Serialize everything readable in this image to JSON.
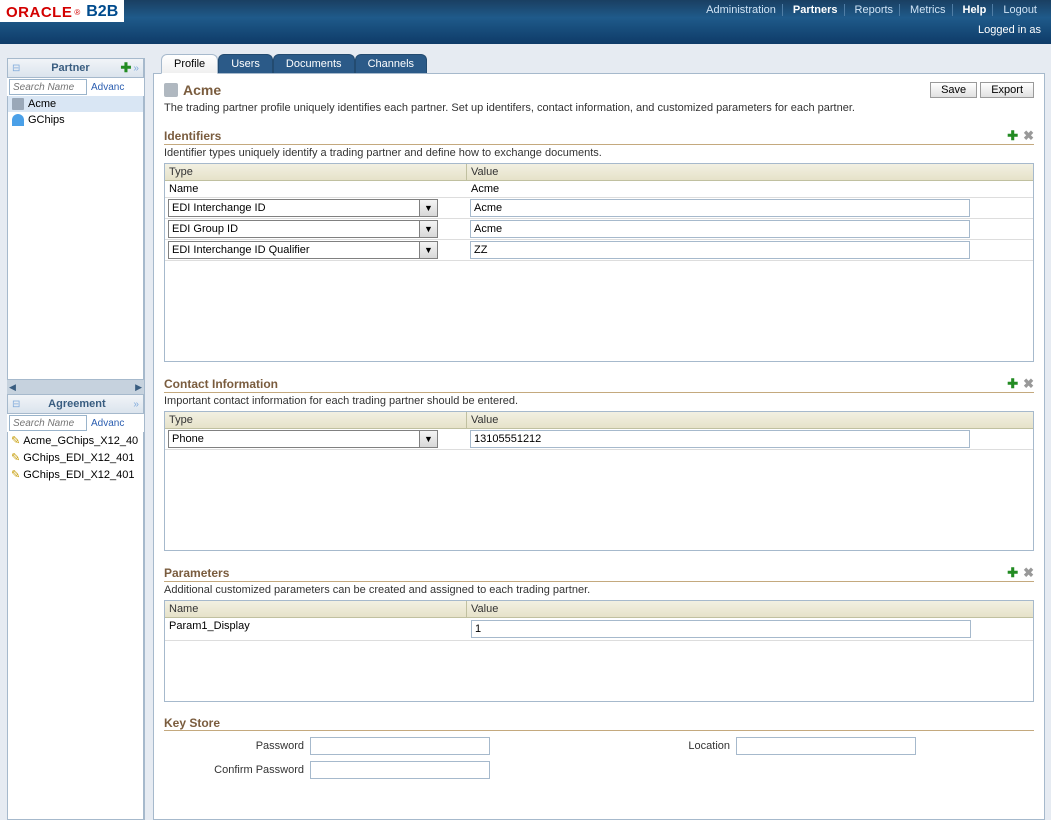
{
  "brand": {
    "oracle": "ORACLE",
    "b2b": "B2B"
  },
  "topnav": {
    "administration": "Administration",
    "partners": "Partners",
    "reports": "Reports",
    "metrics": "Metrics",
    "help": "Help",
    "logout": "Logout"
  },
  "logged_in_label": "Logged in as",
  "sidebar": {
    "partner_title": "Partner",
    "search_placeholder": "Search Name",
    "advanced": "Advanc",
    "items": [
      {
        "label": "Acme"
      },
      {
        "label": "GChips"
      }
    ],
    "agreement_title": "Agreement",
    "agreements": [
      {
        "label": "Acme_GChips_X12_40"
      },
      {
        "label": "GChips_EDI_X12_401"
      },
      {
        "label": "GChips_EDI_X12_401"
      }
    ]
  },
  "tabs": {
    "profile": "Profile",
    "users": "Users",
    "documents": "Documents",
    "channels": "Channels"
  },
  "page": {
    "title": "Acme",
    "desc": "The trading partner profile uniquely identifies each partner. Set up identifers, contact information, and customized parameters for each partner.",
    "save": "Save",
    "export": "Export"
  },
  "identifiers": {
    "title": "Identifiers",
    "desc": "Identifier types uniquely identify a trading partner and define how to exchange documents.",
    "col_type": "Type",
    "col_value": "Value",
    "static_type": "Name",
    "static_value": "Acme",
    "rows": [
      {
        "type": "EDI Interchange ID",
        "value": "Acme"
      },
      {
        "type": "EDI Group ID",
        "value": "Acme"
      },
      {
        "type": "EDI Interchange ID Qualifier",
        "value": "ZZ"
      }
    ]
  },
  "contact": {
    "title": "Contact Information",
    "desc": "Important contact information for each trading partner should be entered.",
    "col_type": "Type",
    "col_value": "Value",
    "rows": [
      {
        "type": "Phone",
        "value": "13105551212"
      }
    ]
  },
  "parameters": {
    "title": "Parameters",
    "desc": "Additional customized parameters can be created and assigned to each trading partner.",
    "col_name": "Name",
    "col_value": "Value",
    "rows": [
      {
        "name": "Param1_Display",
        "value": "1"
      }
    ]
  },
  "keystore": {
    "title": "Key Store",
    "password_label": "Password",
    "confirm_label": "Confirm Password",
    "location_label": "Location"
  }
}
